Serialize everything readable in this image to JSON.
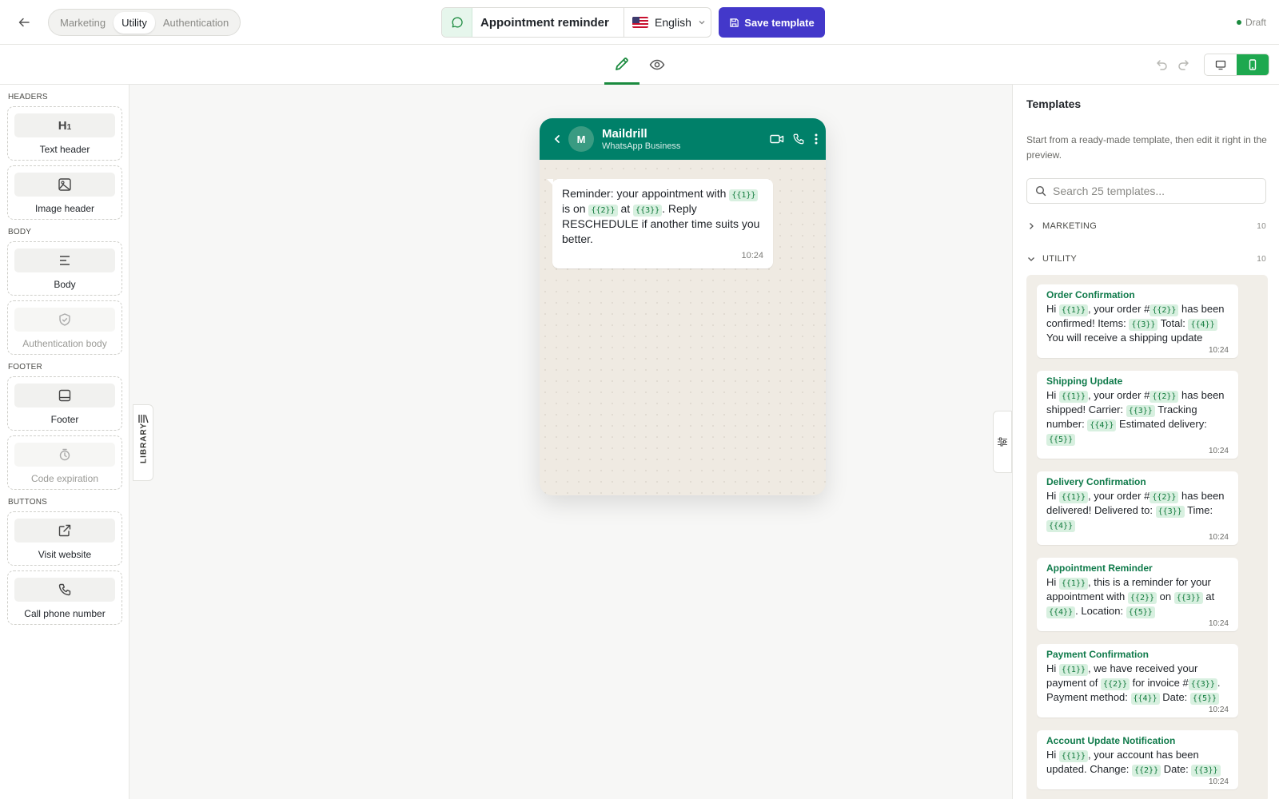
{
  "header": {
    "categories": [
      "Marketing",
      "Utility",
      "Authentication"
    ],
    "active_category": "Utility",
    "template_name": "Appointment reminder",
    "language": "English",
    "save_label": "Save template",
    "status": "Draft"
  },
  "left_panel": {
    "sections": [
      {
        "title": "HEADERS",
        "blocks": [
          {
            "label": "Text header",
            "icon": "heading-icon",
            "enabled": true
          },
          {
            "label": "Image header",
            "icon": "image-icon",
            "enabled": true
          }
        ]
      },
      {
        "title": "BODY",
        "blocks": [
          {
            "label": "Body",
            "icon": "text-align-icon",
            "enabled": true
          },
          {
            "label": "Authentication body",
            "icon": "shield-check-icon",
            "enabled": false
          }
        ]
      },
      {
        "title": "FOOTER",
        "blocks": [
          {
            "label": "Footer",
            "icon": "footer-layout-icon",
            "enabled": true
          },
          {
            "label": "Code expiration",
            "icon": "timer-icon",
            "enabled": false
          }
        ]
      },
      {
        "title": "BUTTONS",
        "blocks": [
          {
            "label": "Visit website",
            "icon": "external-link-icon",
            "enabled": true
          },
          {
            "label": "Call phone number",
            "icon": "phone-icon",
            "enabled": true
          }
        ]
      }
    ],
    "library_tab": "LIBRARY"
  },
  "preview": {
    "business_name": "Maildrill",
    "business_sub": "WhatsApp Business",
    "avatar_letter": "M",
    "message_parts": [
      "Reminder: your appointment with ",
      "{{1}}",
      " is on ",
      "{{2}}",
      " at ",
      "{{3}}",
      ". Reply RESCHEDULE if another time suits you better."
    ],
    "time": "10:24"
  },
  "right_panel": {
    "title": "Templates",
    "description": "Start from a ready-made template, then edit it right in the preview.",
    "search_placeholder": "Search 25 templates...",
    "groups": [
      {
        "name": "MARKETING",
        "count": "10",
        "expanded": false
      },
      {
        "name": "UTILITY",
        "count": "10",
        "expanded": true
      }
    ],
    "templates": [
      {
        "title": "Order Confirmation",
        "parts": [
          "Hi ",
          "{{1}}",
          ", your order #",
          "{{2}}",
          " has been confirmed! Items: ",
          "{{3}}",
          " Total: ",
          "{{4}}",
          " You will receive a shipping update"
        ],
        "time": "10:24"
      },
      {
        "title": "Shipping Update",
        "parts": [
          "Hi ",
          "{{1}}",
          ", your order #",
          "{{2}}",
          " has been shipped! Carrier: ",
          "{{3}}",
          " Tracking number: ",
          "{{4}}",
          " Estimated delivery: ",
          "{{5}}"
        ],
        "time": "10:24"
      },
      {
        "title": "Delivery Confirmation",
        "parts": [
          "Hi ",
          "{{1}}",
          ", your order #",
          "{{2}}",
          " has been delivered! Delivered to: ",
          "{{3}}",
          " Time: ",
          "{{4}}"
        ],
        "time": "10:24"
      },
      {
        "title": "Appointment Reminder",
        "parts": [
          "Hi ",
          "{{1}}",
          ", this is a reminder for your appointment with ",
          "{{2}}",
          " on ",
          "{{3}}",
          " at ",
          "{{4}}",
          ". Location: ",
          "{{5}}"
        ],
        "time": "10:24"
      },
      {
        "title": "Payment Confirmation",
        "parts": [
          "Hi ",
          "{{1}}",
          ", we have received your payment of ",
          "{{2}}",
          " for invoice #",
          "{{3}}",
          ". Payment method: ",
          "{{4}}",
          " Date: ",
          "{{5}}"
        ],
        "time": "10:24"
      },
      {
        "title": "Account Update Notification",
        "parts": [
          "Hi ",
          "{{1}}",
          ", your account has been updated. Change: ",
          "{{2}}",
          " Date: ",
          "{{3}}"
        ],
        "time": "10:24"
      }
    ]
  },
  "colors": {
    "accent": "#1a8a3e",
    "whatsapp_header": "#008069",
    "save_button": "#4338ca"
  }
}
